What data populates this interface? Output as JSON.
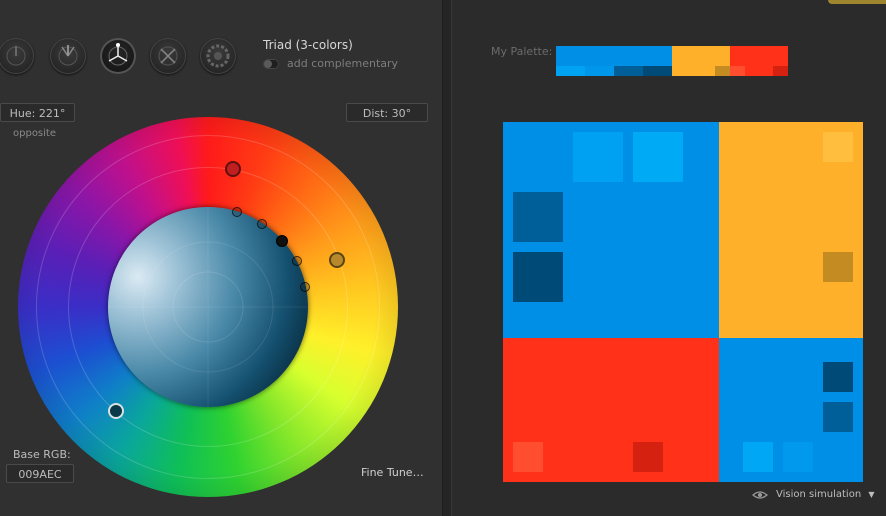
{
  "app": {
    "rule_title": "Triad (3-colors)",
    "add_complementary": "add complementary"
  },
  "mode_icons": [
    {
      "name": "monochromatic-rule-icon"
    },
    {
      "name": "analogic-rule-icon"
    },
    {
      "name": "triad-rule-icon"
    },
    {
      "name": "tetrad-rule-icon"
    },
    {
      "name": "custom-rule-icon"
    }
  ],
  "controls": {
    "hue": "Hue: 221°",
    "dist": "Dist: 30°",
    "opposite": "opposite",
    "base_rgb_label": "Base RGB:",
    "base_rgb_value": "009AEC",
    "fine_tune": "Fine Tune…"
  },
  "palette": {
    "label": "My Palette:",
    "main_colors": [
      "#008fe6",
      "#ffb02a",
      "#ff3219"
    ],
    "shade_colors": {
      "blue": [
        "#00a3f2",
        "#0096ea",
        "#005f99",
        "#004a78"
      ],
      "orange": [
        "#ffb02a",
        "#c48b22"
      ],
      "red": [
        "#ff3219",
        "#d5210f"
      ]
    }
  },
  "preview": {
    "colors": {
      "blue": "#008fe6",
      "orange": "#ffb02a",
      "red": "#ff3219",
      "blue_light": "#00a0f2",
      "blue_dark1": "#005f99",
      "blue_dark2": "#004a78",
      "orange_dark": "#c48b22",
      "orange_light": "#ffbe3e",
      "red_light": "#ff4d2f",
      "red_dark": "#d5210f"
    }
  },
  "footer": {
    "vision_simulation": "Vision simulation"
  }
}
